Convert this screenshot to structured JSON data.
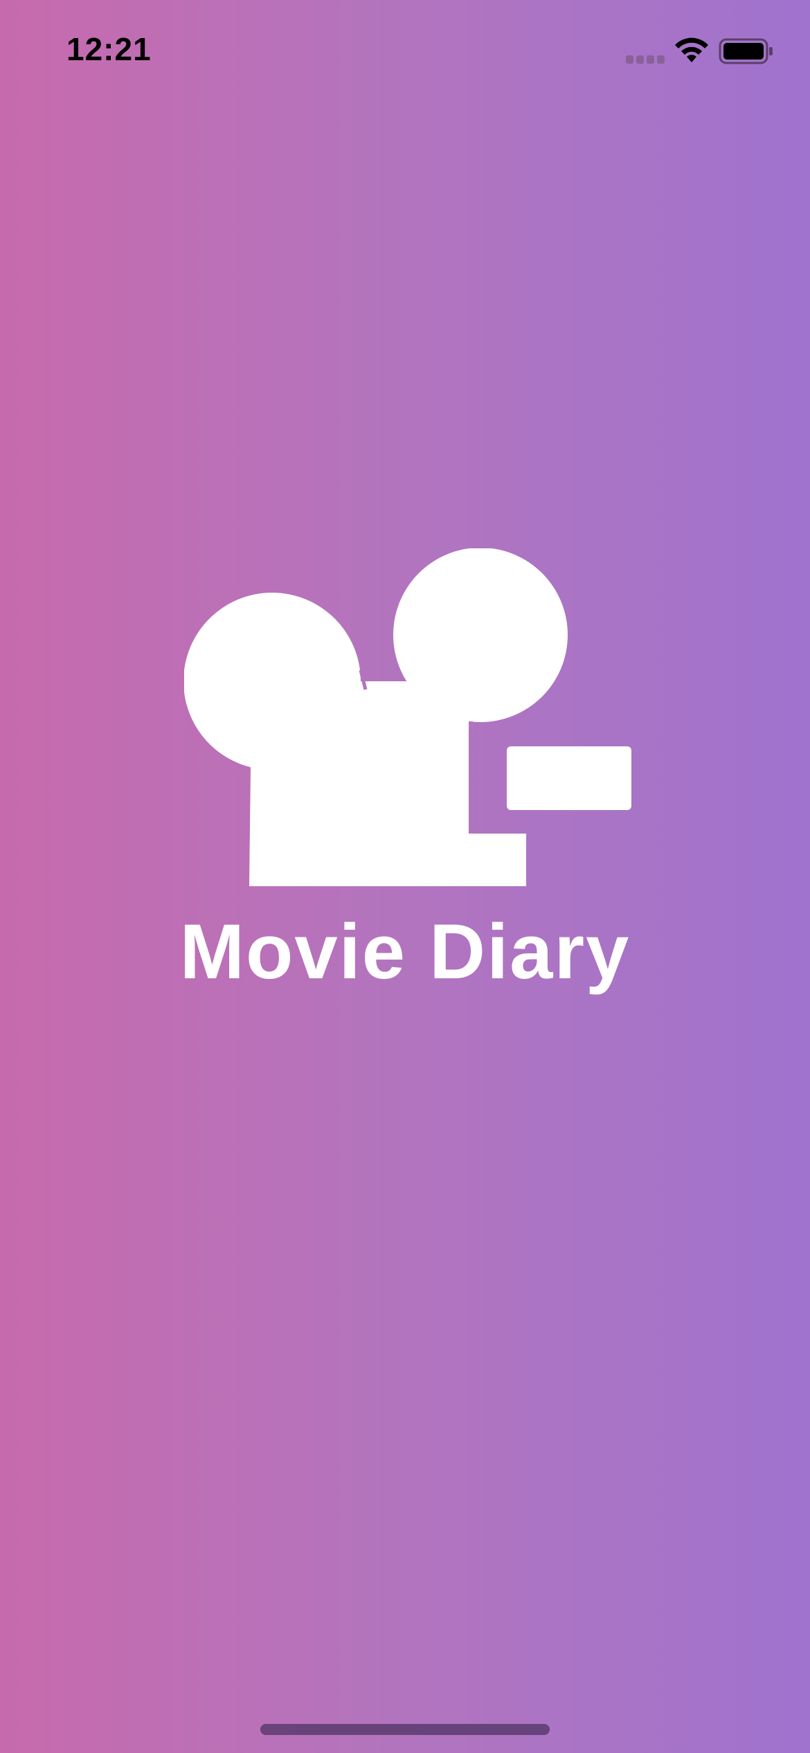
{
  "status_bar": {
    "time": "12:21",
    "signal_icon": "cellular-signal-icon",
    "wifi_icon": "wifi-icon",
    "battery_icon": "battery-icon"
  },
  "splash": {
    "logo_icon": "movie-camera-icon",
    "app_name": "Movie Diary"
  },
  "colors": {
    "gradient_start": "#c76aad",
    "gradient_end": "#a073ce",
    "foreground": "#ffffff",
    "status_text": "#000000"
  }
}
